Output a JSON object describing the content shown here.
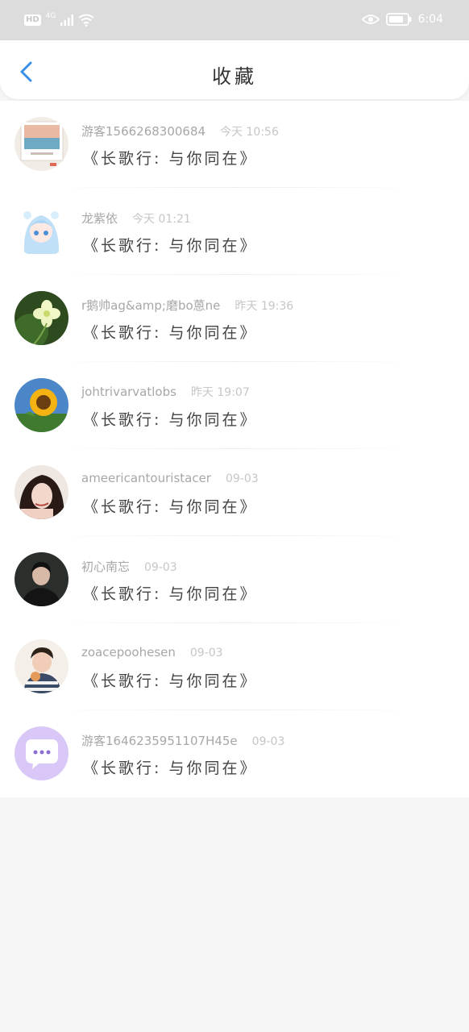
{
  "status_bar": {
    "hd": "HD",
    "network": "4G",
    "time": "6:04"
  },
  "header": {
    "title": "收藏"
  },
  "favorites": [
    {
      "user": "游客1566268300684",
      "time": "今天 10:56",
      "title": "《长歌行: 与你同在》",
      "avatar": "photo-frame-avatar"
    },
    {
      "user": "龙紫依",
      "time": "今天 01:21",
      "title": "《长歌行: 与你同在》",
      "avatar": "anime-girl-avatar"
    },
    {
      "user": "r鹅帅ag&amp;磨bo蒽ne",
      "time": "昨天 19:36",
      "title": "《长歌行: 与你同在》",
      "avatar": "flower-avatar"
    },
    {
      "user": "johtrivarvatlobs",
      "time": "昨天 19:07",
      "title": "《长歌行: 与你同在》",
      "avatar": "sunflower-avatar"
    },
    {
      "user": "ameericantouristacer",
      "time": "09-03",
      "title": "《长歌行: 与你同在》",
      "avatar": "woman-portrait-avatar"
    },
    {
      "user": "初心南忘",
      "time": "09-03",
      "title": "《长歌行: 与你同在》",
      "avatar": "man-portrait-avatar"
    },
    {
      "user": "zoacepoohesen",
      "time": "09-03",
      "title": "《长歌行: 与你同在》",
      "avatar": "child-portrait-avatar"
    },
    {
      "user": "游客1646235951107H45e",
      "time": "09-03",
      "title": "《长歌行: 与你同在》",
      "avatar": "chat-bubble-avatar"
    }
  ],
  "colors": {
    "back_arrow": "#3a8ee6",
    "status_bar_bg": "#dcdcdc",
    "page_bg": "#f6f6f6"
  }
}
